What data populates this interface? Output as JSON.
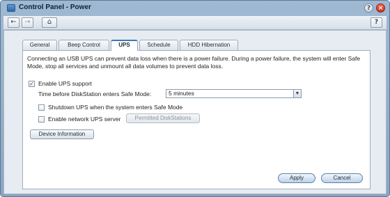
{
  "window": {
    "title": "Control Panel - Power"
  },
  "toolbar": {
    "back": "←",
    "forward": "→",
    "home": "⌂",
    "help": "?"
  },
  "titlebar_buttons": {
    "help": "?",
    "close": "×"
  },
  "tabs": [
    {
      "label": "General",
      "active": false
    },
    {
      "label": "Beep Control",
      "active": false
    },
    {
      "label": "UPS",
      "active": true
    },
    {
      "label": "Schedule",
      "active": false
    },
    {
      "label": "HDD Hibernation",
      "active": false
    }
  ],
  "ups": {
    "description": "Connecting an USB UPS can prevent data loss when there is a power failure. During a power failure, the system will enter Safe Mode, stop all services and unmount all data volumes to prevent data loss.",
    "enable_ups_label": "Enable UPS support",
    "enable_ups_checked": true,
    "safe_mode_label": "Time before DiskStation enters Safe Mode:",
    "safe_mode_value": "5 minutes",
    "shutdown_label": "Shutdown UPS when the system enters Safe Mode",
    "shutdown_checked": false,
    "network_label": "Enable network UPS server",
    "network_checked": false,
    "permitted_button": "Permitted DiskStations",
    "device_info_button": "Device Information"
  },
  "footer": {
    "apply": "Apply",
    "cancel": "Cancel"
  },
  "colors": {
    "accent": "#3d77b8",
    "panel_bg": "#e6ecf2",
    "close": "#c73420"
  },
  "check_glyph": "✓"
}
